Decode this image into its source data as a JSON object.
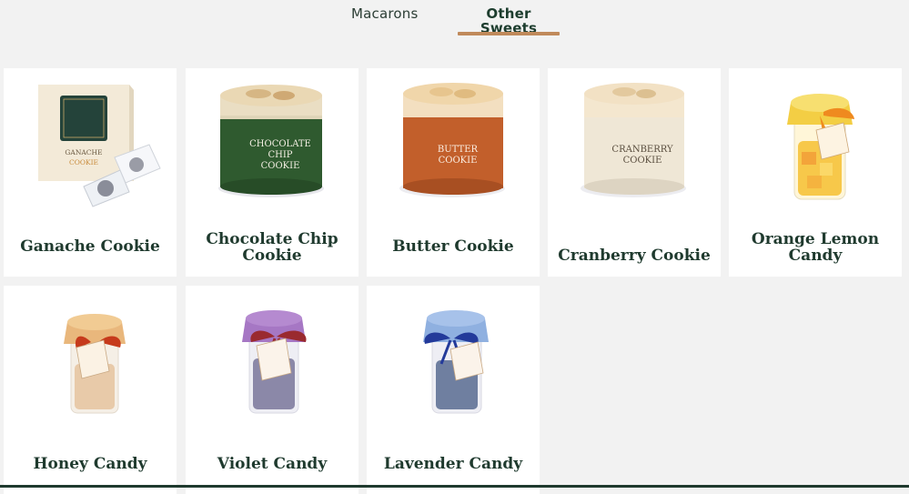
{
  "tabs": [
    {
      "label": "Macarons",
      "active": false
    },
    {
      "label": "Other Sweets",
      "active": true
    }
  ],
  "colors": {
    "accent_underline": "#c08a5b",
    "title_green": "#1f3a2e",
    "background": "#f2f2f2"
  },
  "products": [
    {
      "name": "Ganache Cookie",
      "image": "ganache-cookie-box-image"
    },
    {
      "name": "Chocolate Chip Cookie",
      "image": "chocolate-chip-cookie-tin-image"
    },
    {
      "name": "Butter Cookie",
      "image": "butter-cookie-tin-image"
    },
    {
      "name": "Cranberry Cookie",
      "image": "cranberry-cookie-tin-image"
    },
    {
      "name": "Orange Lemon Candy",
      "image": "orange-lemon-candy-jar-image"
    },
    {
      "name": "Honey Candy",
      "image": "honey-candy-jar-image"
    },
    {
      "name": "Violet Candy",
      "image": "violet-candy-jar-image"
    },
    {
      "name": "Lavender Candy",
      "image": "lavender-candy-jar-image"
    }
  ],
  "package_labels": {
    "ganache": [
      "GANACHE",
      "COOKIE"
    ],
    "chocolate_chip": [
      "CHOCOLATE",
      "CHIP",
      "COOKIE"
    ],
    "butter": [
      "BUTTER",
      "COOKIE"
    ],
    "cranberry": [
      "CRANBERRY",
      "COOKIE"
    ]
  }
}
